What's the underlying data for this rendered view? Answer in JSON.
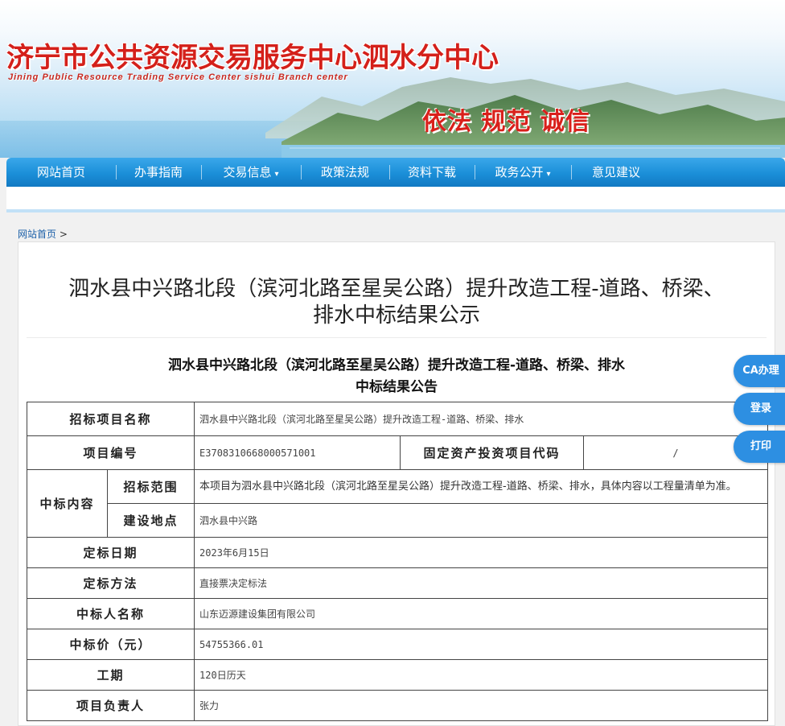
{
  "header": {
    "title": "济宁市公共资源交易服务中心泗水分中心",
    "subtitle": "Jining Public Resource Trading Service Center sishui Branch center",
    "slogan": "依法 规范 诚信"
  },
  "nav": {
    "items": [
      {
        "label": "网站首页",
        "dropdown": false
      },
      {
        "label": "办事指南",
        "dropdown": false
      },
      {
        "label": "交易信息",
        "dropdown": true
      },
      {
        "label": "政策法规",
        "dropdown": false
      },
      {
        "label": "资料下载",
        "dropdown": false
      },
      {
        "label": "政务公开",
        "dropdown": true
      },
      {
        "label": "意见建议",
        "dropdown": false
      }
    ],
    "caret": "▾"
  },
  "breadcrumb": {
    "home": "网站首页",
    "separator": ">"
  },
  "article": {
    "title_line1": "泗水县中兴路北段（滨河北路至星吴公路）提升改造工程-道路、桥梁、",
    "title_line2": "排水中标结果公示",
    "notice_title_line1": "泗水县中兴路北段（滨河北路至星吴公路）提升改造工程-道路、桥梁、排水",
    "notice_title_line2": "中标结果公告"
  },
  "table": {
    "project_name_label": "招标项目名称",
    "project_name": "泗水县中兴路北段（滨河北路至星吴公路）提升改造工程-道路、桥梁、排水",
    "project_no_label": "项目编号",
    "project_no": "E3708310668000571001",
    "fixed_asset_label": "固定资产投资项目代码",
    "fixed_asset_code": "/",
    "content_label": "中标内容",
    "scope_label": "招标范围",
    "scope": "本项目为泗水县中兴路北段（滨河北路至星吴公路）提升改造工程-道路、桥梁、排水，具体内容以工程量清单为准。",
    "location_label": "建设地点",
    "location": "泗水县中兴路",
    "award_date_label": "定标日期",
    "award_date": "2023年6月15日",
    "award_method_label": "定标方法",
    "award_method": "直接票决定标法",
    "winner_label": "中标人名称",
    "winner": "山东迈源建设集团有限公司",
    "price_label": "中标价（元）",
    "price": "54755366.01",
    "duration_label": "工期",
    "duration": "120日历天",
    "manager_label": "项目负责人",
    "manager": "张力"
  },
  "side_buttons": {
    "ca": "CA办理",
    "login": "登录",
    "print": "打印"
  },
  "colors": {
    "brand_red": "#d4201a",
    "nav_blue": "#1b8fd8",
    "float_blue": "#2d8fe2"
  }
}
